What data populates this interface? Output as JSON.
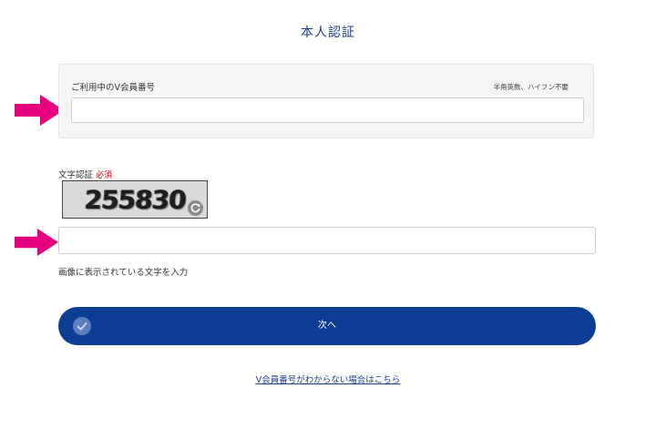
{
  "page": {
    "title": "本人認証"
  },
  "member": {
    "label": "ご利用中のV会員番号",
    "hint": "半角英数、ハイフン不要",
    "value": "",
    "placeholder": ""
  },
  "captcha": {
    "label": "文字認証",
    "required": "必須",
    "image_text": "255830",
    "value": "",
    "placeholder": "",
    "help": "画像に表示されている文字を入力"
  },
  "actions": {
    "next_label": "次へ",
    "forgot_link": "V会員番号がわからない場合はこちら"
  },
  "icons": {
    "annotation_arrow": "right-arrow-icon",
    "refresh": "refresh-icon",
    "check": "check-circle-icon"
  },
  "colors": {
    "accent": "#0b3d94",
    "title": "#1c3d8c",
    "required": "#d0021b",
    "arrow": "#e6007e"
  }
}
